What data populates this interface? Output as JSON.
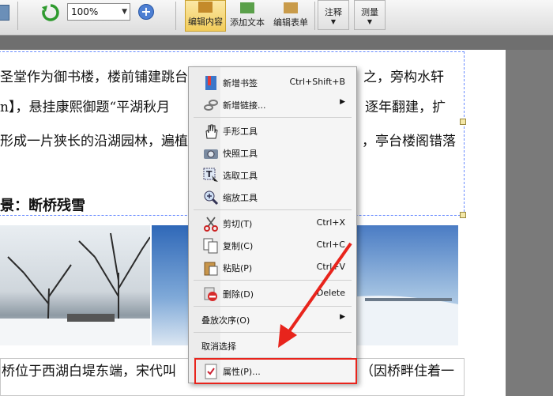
{
  "toolbar": {
    "zoom_value": "100%",
    "buttons": [
      {
        "label": "编辑内容"
      },
      {
        "label": "添加文本"
      },
      {
        "label": "编辑表单"
      },
      {
        "label": "注释"
      },
      {
        "label": "测量"
      }
    ]
  },
  "document": {
    "paragraphs": [
      "圣堂作为御书楼，楼前铺建跳台",
      "之，旁构水轩",
      "n】，悬挂康熙御题“平湖秋月",
      "逐年翻建，扩",
      "形成一片狭长的沿湖园林，遍植",
      "，亭台楼阁错落"
    ],
    "heading": "景：断桥残雪",
    "bottom_line_left": "桥位于西湖白堤东端，宋代叫",
    "bottom_line_right": "（因桥畔住着一"
  },
  "context_menu": {
    "items": [
      {
        "label": "新增书签",
        "shortcut": "Ctrl+Shift+B"
      },
      {
        "label": "新增链接...",
        "submenu": "▶"
      },
      {
        "label": "手形工具"
      },
      {
        "label": "快照工具"
      },
      {
        "label": "选取工具"
      },
      {
        "label": "缩放工具"
      },
      {
        "label": "剪切(T)",
        "shortcut": "Ctrl+X"
      },
      {
        "label": "复制(C)",
        "shortcut": "Ctrl+C"
      },
      {
        "label": "粘贴(P)",
        "shortcut": "Ctrl+V"
      },
      {
        "label": "删除(D)",
        "shortcut": "Delete"
      },
      {
        "label": "叠放次序(O)",
        "submenu": "▶"
      },
      {
        "label": "取消选择"
      },
      {
        "label": "属性(P)..."
      }
    ]
  },
  "colors": {
    "annotation_red": "#e8241c",
    "selection_frame": "#6a8cff"
  }
}
